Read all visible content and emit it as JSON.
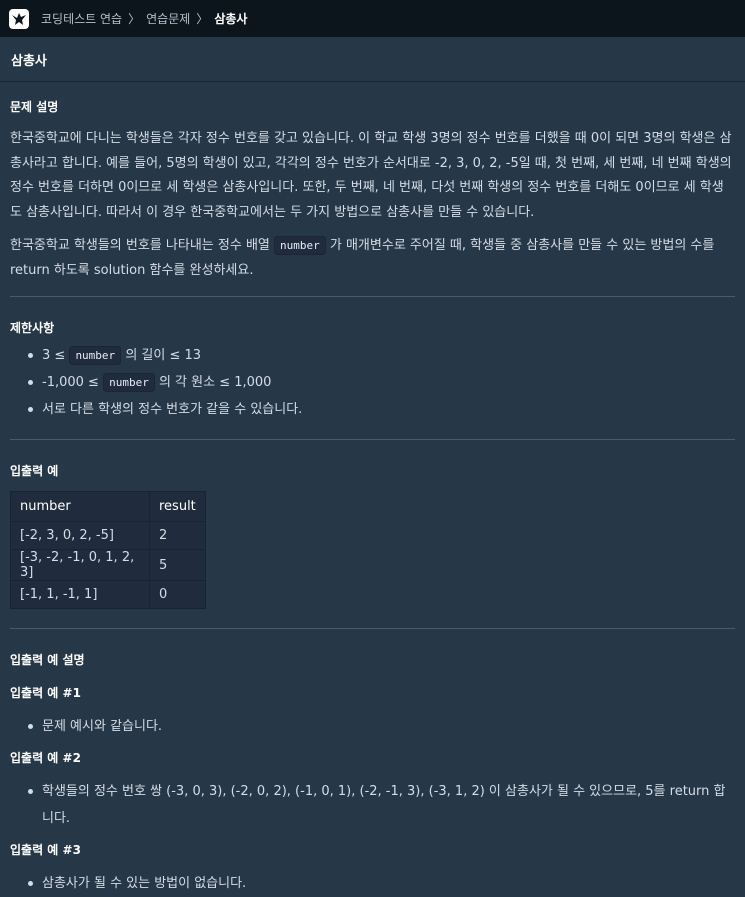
{
  "breadcrumb": {
    "items": [
      "코딩테스트 연습",
      "연습문제"
    ],
    "current": "삼총사",
    "separator": "〉"
  },
  "page_title": "삼총사",
  "description": {
    "heading": "문제 설명",
    "para1": "한국중학교에 다니는 학생들은 각자 정수 번호를 갖고 있습니다. 이 학교 학생 3명의 정수 번호를 더했을 때 0이 되면 3명의 학생은 삼총사라고 합니다. 예를 들어, 5명의 학생이 있고, 각각의 정수 번호가 순서대로 -2, 3, 0, 2, -5일 때, 첫 번째, 세 번째, 네 번째 학생의 정수 번호를 더하면 0이므로 세 학생은 삼총사입니다. 또한, 두 번째, 네 번째, 다섯 번째 학생의 정수 번호를 더해도 0이므로 세 학생도 삼총사입니다. 따라서 이 경우 한국중학교에서는 두 가지 방법으로 삼총사를 만들 수 있습니다.",
    "para2_pre": "한국중학교 학생들의 번호를 나타내는 정수 배열 ",
    "para2_code": "number",
    "para2_post": " 가 매개변수로 주어질 때, 학생들 중 삼총사를 만들 수 있는 방법의 수를 return 하도록 solution 함수를 완성하세요."
  },
  "constraints": {
    "heading": "제한사항",
    "c1_pre": "3 ≤ ",
    "c1_code": "number",
    "c1_post": " 의 길이 ≤ 13",
    "c2_pre": "-1,000 ≤ ",
    "c2_code": "number",
    "c2_post": " 의 각 원소 ≤ 1,000",
    "c3": "서로 다른 학생의 정수 번호가 같을 수 있습니다."
  },
  "examples": {
    "heading": "입출력 예",
    "headers": [
      "number",
      "result"
    ],
    "rows": [
      [
        "[-2, 3, 0, 2, -5]",
        "2"
      ],
      [
        "[-3, -2, -1, 0, 1, 2, 3]",
        "5"
      ],
      [
        "[-1, 1, -1, 1]",
        "0"
      ]
    ]
  },
  "explanation": {
    "heading": "입출력 예 설명",
    "ex1_title": "입출력 예 #1",
    "ex1_text": "문제 예시와 같습니다.",
    "ex2_title": "입출력 예 #2",
    "ex2_text": "학생들의 정수 번호 쌍 (-3, 0, 3), (-2, 0, 2), (-1, 0, 1), (-2, -1, 3), (-3, 1, 2) 이 삼총사가 될 수 있으므로, 5를 return 합니다.",
    "ex3_title": "입출력 예 #3",
    "ex3_text": "삼총사가 될 수 있는 방법이 없습니다."
  }
}
